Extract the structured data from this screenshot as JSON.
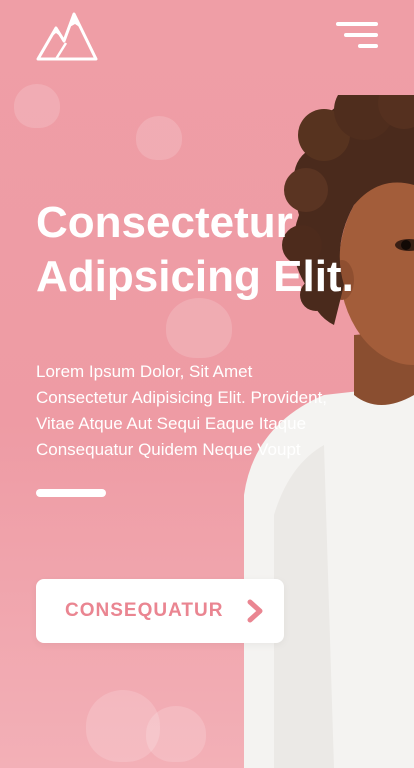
{
  "brand": {
    "logo_icon": "mountain-logo-icon"
  },
  "header": {
    "menu_icon": "hamburger-menu-icon"
  },
  "hero": {
    "headline_line1": "Consectetur",
    "headline_line2": "Adipsicing Elit.",
    "description": " Lorem Ipsum Dolor, Sit Amet\nConsectetur Adipisicing Elit. Provident,\nVitae  Atque Aut Sequi Eaque Itaque\nConsequatur Quidem Neque Voupt",
    "cta_label": "CONSEQUATUR",
    "cta_icon": "chevron-right-icon"
  },
  "colors": {
    "background": "#ef9ea6",
    "accent": "#ea8591",
    "text": "#ffffff"
  }
}
